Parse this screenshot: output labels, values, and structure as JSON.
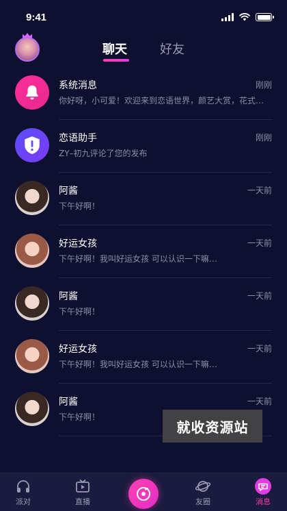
{
  "status_bar": {
    "time": "9:41"
  },
  "header": {
    "tabs": [
      {
        "label": "聊天",
        "active": true
      },
      {
        "label": "好友",
        "active": false
      }
    ],
    "accent_color": "#ff3fa8"
  },
  "messages": [
    {
      "name": "系统消息",
      "time": "刚刚",
      "preview": "你好呀，小可爱！欢迎来到恋语世界，颜艺大赏，花式整蛊…",
      "avatar": "bell-icon"
    },
    {
      "name": "恋语助手",
      "time": "刚刚",
      "preview": "ZY–初九评论了您的发布",
      "avatar": "alert-icon"
    },
    {
      "name": "阿酱",
      "time": "一天前",
      "preview": "下午好啊！",
      "avatar": "user-avatar"
    },
    {
      "name": "好运女孩",
      "time": "一天前",
      "preview": "下午好啊！我叫好运女孩  可以认识一下嘛…",
      "avatar": "user-avatar"
    },
    {
      "name": "阿酱",
      "time": "一天前",
      "preview": "下午好啊！",
      "avatar": "user-avatar"
    },
    {
      "name": "好运女孩",
      "time": "一天前",
      "preview": "下午好啊！我叫好运女孩  可以认识一下嘛…",
      "avatar": "user-avatar"
    },
    {
      "name": "阿酱",
      "time": "一天前",
      "preview": "下午好啊！",
      "avatar": "user-avatar"
    }
  ],
  "watermark": "就收资源站",
  "tabbar": {
    "items": [
      {
        "label": "派对",
        "icon": "headphones-icon",
        "active": false
      },
      {
        "label": "直播",
        "icon": "tv-icon",
        "active": false
      },
      {
        "label": "",
        "icon": "record-icon",
        "active": false
      },
      {
        "label": "友圈",
        "icon": "planet-icon",
        "active": false
      },
      {
        "label": "消息",
        "icon": "chat-bubble-icon",
        "active": true
      }
    ]
  }
}
